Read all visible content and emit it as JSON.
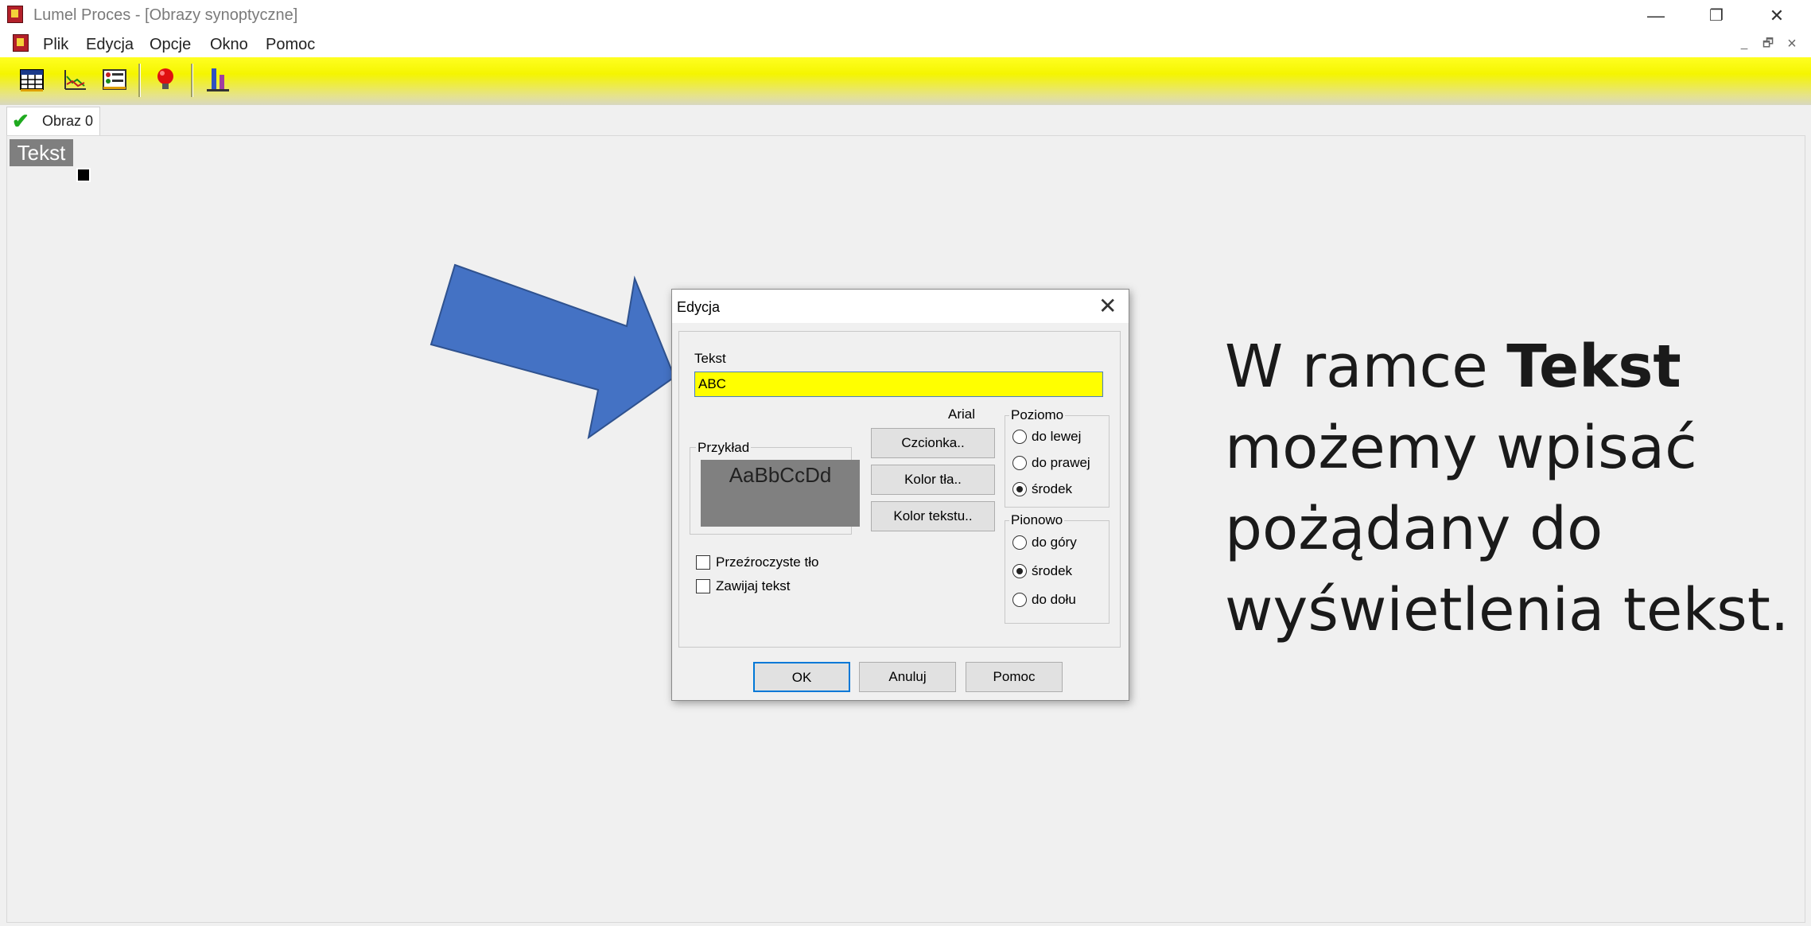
{
  "window": {
    "title": "Lumel Proces - [Obrazy synoptyczne]",
    "controls": {
      "minimize": "—",
      "restore": "❐",
      "close": "✕"
    }
  },
  "menu": {
    "items": [
      "Plik",
      "Edycja",
      "Opcje",
      "Okno",
      "Pomoc"
    ],
    "mdi_controls": {
      "minimize": "_",
      "restore": "🗗",
      "close": "×"
    }
  },
  "toolbar": {
    "buttons": [
      "table-icon",
      "chart-icon",
      "list-icon",
      "alarm-bulb-icon",
      "process-icon"
    ]
  },
  "tabs": [
    {
      "label": "Obraz 0",
      "icon": "green-check-icon"
    }
  ],
  "canvas": {
    "text_object": "Tekst"
  },
  "dialog": {
    "title": "Edycja",
    "close": "✕",
    "text_label": "Tekst",
    "text_value": "ABC",
    "font_name": "Arial",
    "preview_label": "Przykład",
    "preview_text": "AaBbCcDd",
    "buttons": {
      "font": "Czcionka..",
      "bg_color": "Kolor tła..",
      "text_color": "Kolor tekstu.."
    },
    "horizontal": {
      "label": "Poziomo",
      "options": [
        "do lewej",
        "do prawej",
        "środek"
      ],
      "selected": "środek"
    },
    "vertical": {
      "label": "Pionowo",
      "options": [
        "do góry",
        "środek",
        "do dołu"
      ],
      "selected": "środek"
    },
    "checkboxes": {
      "transparent": "Przeźroczyste tło",
      "wrap": "Zawijaj tekst"
    },
    "footer": {
      "ok": "OK",
      "cancel": "Anuluj",
      "help": "Pomoc"
    }
  },
  "annotation": {
    "part1": "W ramce ",
    "bold": "Tekst",
    "part2": "możemy wpisać",
    "line3": "pożądany do",
    "line4": "wyświetlenia tekst."
  },
  "colors": {
    "toolbar_yellow": "#f5f500",
    "input_yellow": "#ffff00",
    "arrow_blue": "#4472c4",
    "preview_gray": "#808080"
  }
}
